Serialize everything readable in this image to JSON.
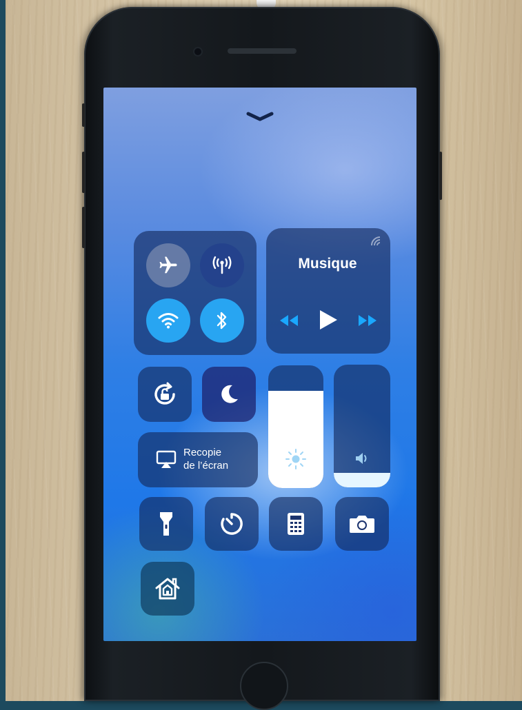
{
  "control_center": {
    "connectivity": {
      "airplane": {
        "icon": "airplane-icon",
        "state": "off"
      },
      "cellular": {
        "icon": "cellular-antenna-icon",
        "state": "on"
      },
      "wifi": {
        "icon": "wifi-icon",
        "state": "on"
      },
      "bluetooth": {
        "icon": "bluetooth-icon",
        "state": "on"
      }
    },
    "music": {
      "title": "Musique",
      "airplay_icon": "airplay-waves-icon",
      "controls": [
        "rewind-icon",
        "play-icon",
        "fast-forward-icon"
      ]
    },
    "orientation_lock": {
      "icon": "orientation-lock-icon"
    },
    "do_not_disturb": {
      "icon": "moon-icon"
    },
    "screen_mirroring": {
      "line1": "Recopie",
      "line2": "de l’écran",
      "icon": "screen-mirroring-icon"
    },
    "brightness": {
      "icon": "sun-icon",
      "level": 0.79
    },
    "volume": {
      "icon": "speaker-icon",
      "level": 0.12
    },
    "shortcuts": [
      "flashlight-icon",
      "timer-icon",
      "calculator-icon",
      "camera-icon"
    ],
    "home": {
      "icon": "home-icon"
    }
  },
  "colors": {
    "tile": "#142a5a",
    "active_blue": "#28a5f2",
    "white": "#ffffff"
  }
}
